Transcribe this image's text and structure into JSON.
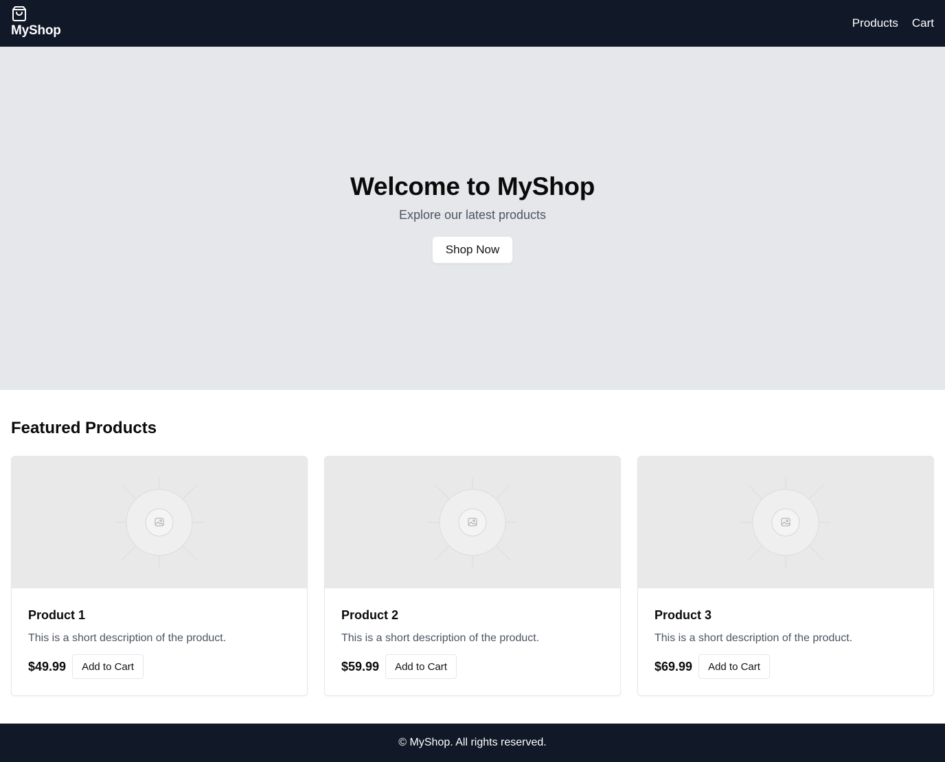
{
  "header": {
    "brand_icon": "shopping-bag-icon",
    "brand_name": "MyShop",
    "nav": [
      {
        "label": "Products"
      },
      {
        "label": "Cart"
      }
    ]
  },
  "hero": {
    "title": "Welcome to MyShop",
    "subtitle": "Explore our latest products",
    "button_label": "Shop Now"
  },
  "featured": {
    "title": "Featured Products",
    "products": [
      {
        "name": "Product 1",
        "description": "This is a short description of the product.",
        "price": "$49.99",
        "button_label": "Add to Cart",
        "image_icon": "image-placeholder-icon"
      },
      {
        "name": "Product 2",
        "description": "This is a short description of the product.",
        "price": "$59.99",
        "button_label": "Add to Cart",
        "image_icon": "image-placeholder-icon"
      },
      {
        "name": "Product 3",
        "description": "This is a short description of the product.",
        "price": "$69.99",
        "button_label": "Add to Cart",
        "image_icon": "image-placeholder-icon"
      }
    ]
  },
  "footer": {
    "text": "© MyShop. All rights reserved."
  },
  "colors": {
    "header_bg": "#111827",
    "hero_bg": "#e5e7eb",
    "footer_bg": "#111827",
    "muted_text": "#4b5563",
    "card_image_bg": "#e9e9e9"
  }
}
